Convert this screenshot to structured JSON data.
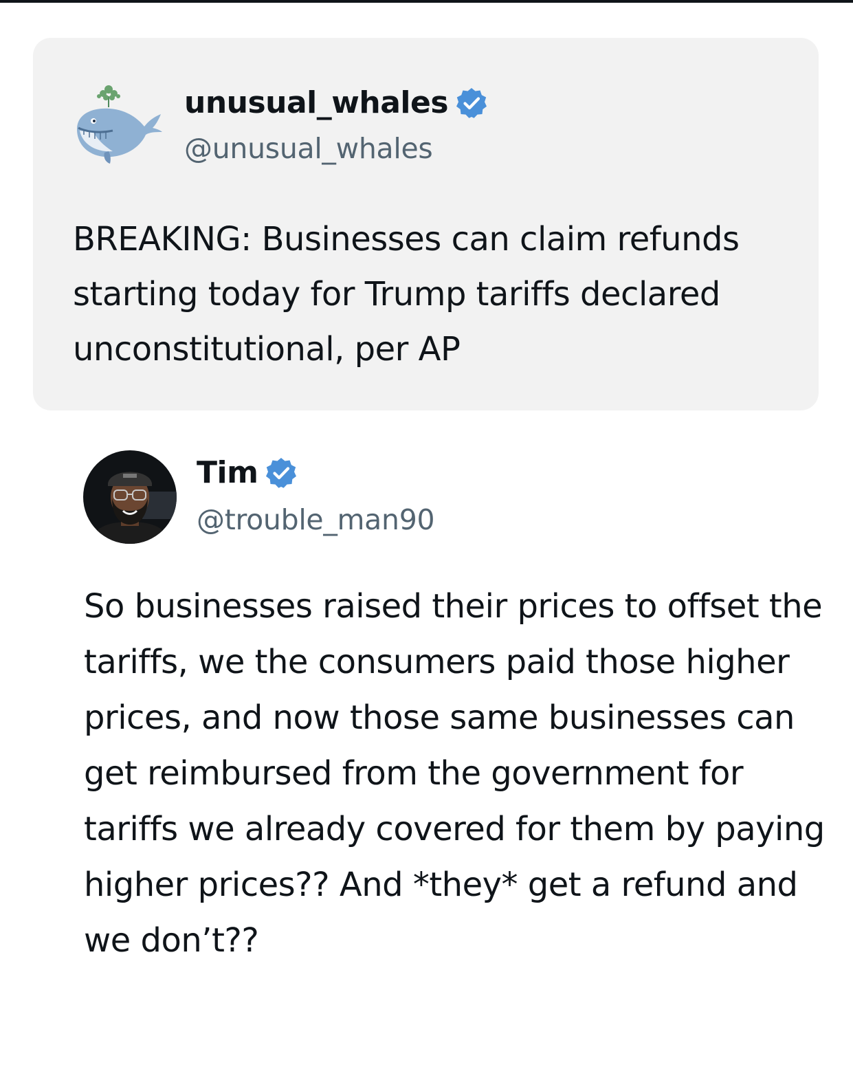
{
  "quoted_post": {
    "display_name": "unusual_whales",
    "handle": "@unusual_whales",
    "verified": true,
    "avatar_icon": "whale-icon",
    "text": "BREAKING: Businesses can claim refunds starting today for Trump tariffs declared unconstitutional, per AP"
  },
  "post": {
    "display_name": "Tim",
    "handle": "@trouble_man90",
    "verified": true,
    "avatar_icon": "user-photo",
    "text": "So businesses raised their prices to offset the tariffs, we the consumers paid those higher prices, and now those same businesses can get reimbursed from the government for tariffs we already covered for them by paying higher prices?? And *they* get a refund and we don’t??"
  },
  "colors": {
    "verified_badge": "#4a90d9",
    "card_background": "#f2f2f2",
    "handle_text": "#536471",
    "body_text": "#0f1419"
  }
}
